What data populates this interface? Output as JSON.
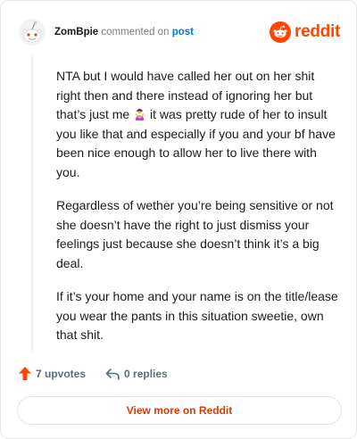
{
  "header": {
    "username": "ZomBpie",
    "action_text": "commented on",
    "target_link": "post",
    "brand_word": "reddit"
  },
  "comment": {
    "paragraphs": [
      {
        "before_emoji": "NTA but I would have called her out on her shit right then and there instead of ignoring her but that’s just me ",
        "emoji": "person-gesturing-no-emoji",
        "after_emoji": " it was pretty rude of her to insult you like that and especially if you and your bf have been nice enough to allow her to live there with you."
      },
      {
        "text": "Regardless of wether you’re being sensitive or not she doesn’t have the right to just dismiss your feelings just because she doesn’t think it’s a big deal."
      },
      {
        "text": "If it’s your home and your name is on the title/lease you wear the pants in this situation sweetie, own that shit."
      }
    ]
  },
  "actions": {
    "upvotes": "7 upvotes",
    "replies": "0 replies"
  },
  "footer": {
    "view_more": "View more on Reddit"
  },
  "colors": {
    "brand": "#ff4500",
    "link": "#0079d3",
    "view_more": "#d93a00"
  }
}
